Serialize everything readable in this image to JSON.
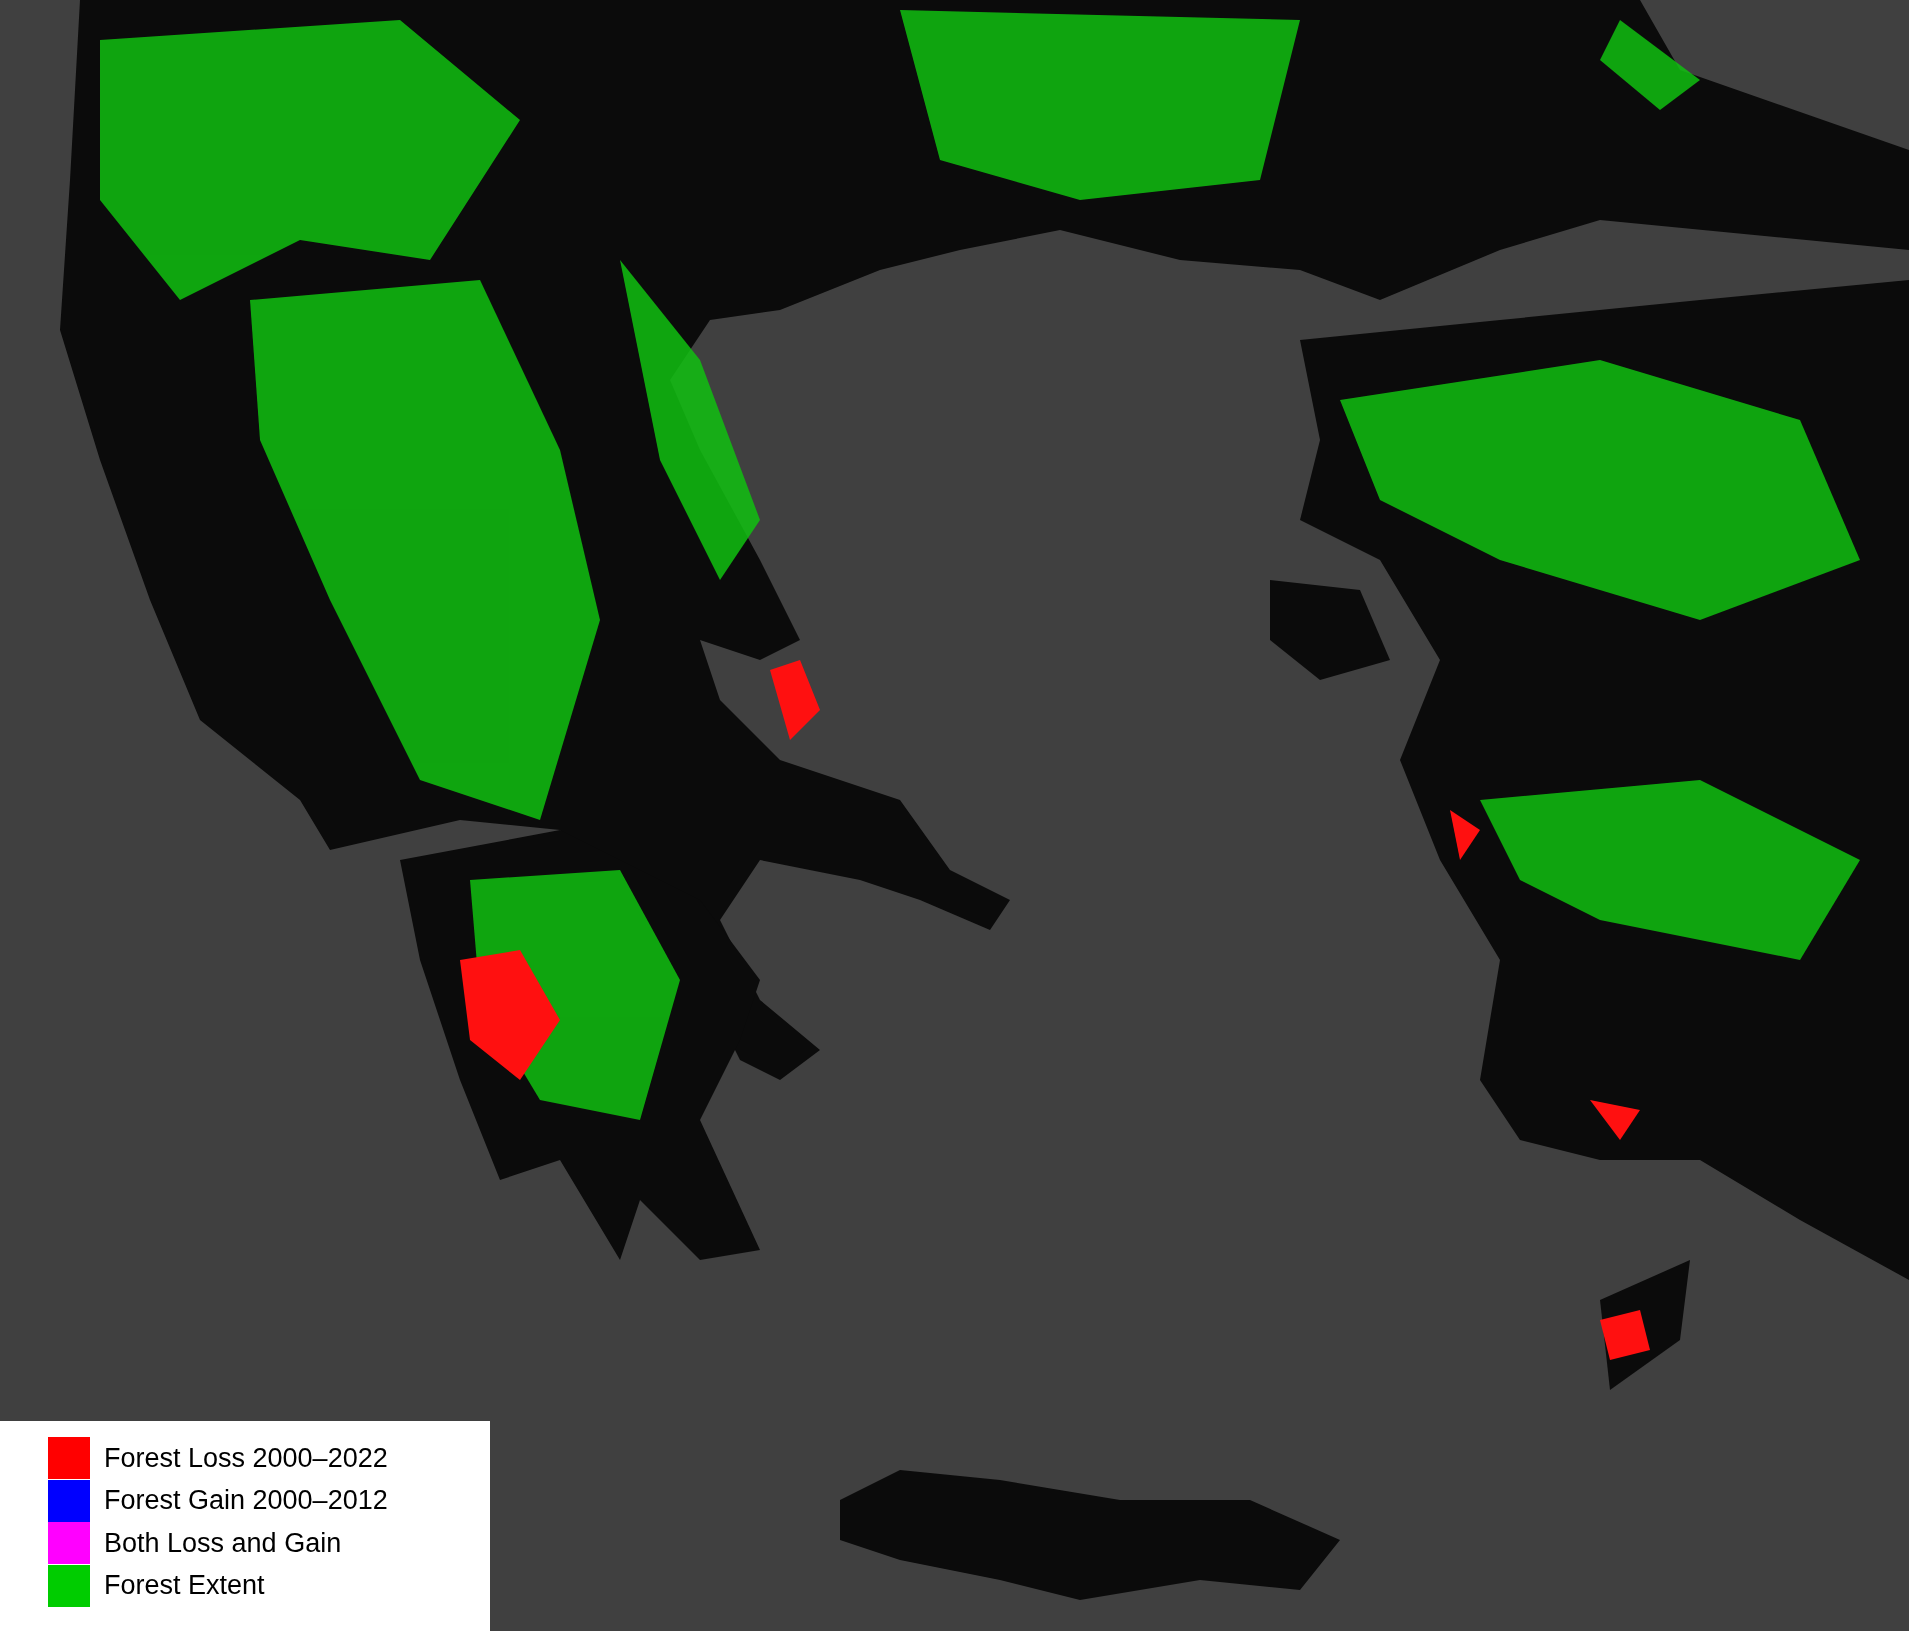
{
  "legend": {
    "items": [
      {
        "label": "Forest Loss 2000–2022",
        "color": "#ff0000"
      },
      {
        "label": "Forest Gain 2000–2012",
        "color": "#0000ff"
      },
      {
        "label": "Both Loss and Gain",
        "color": "#ff00ff"
      },
      {
        "label": "Forest Extent",
        "color": "#00cc00"
      }
    ]
  }
}
